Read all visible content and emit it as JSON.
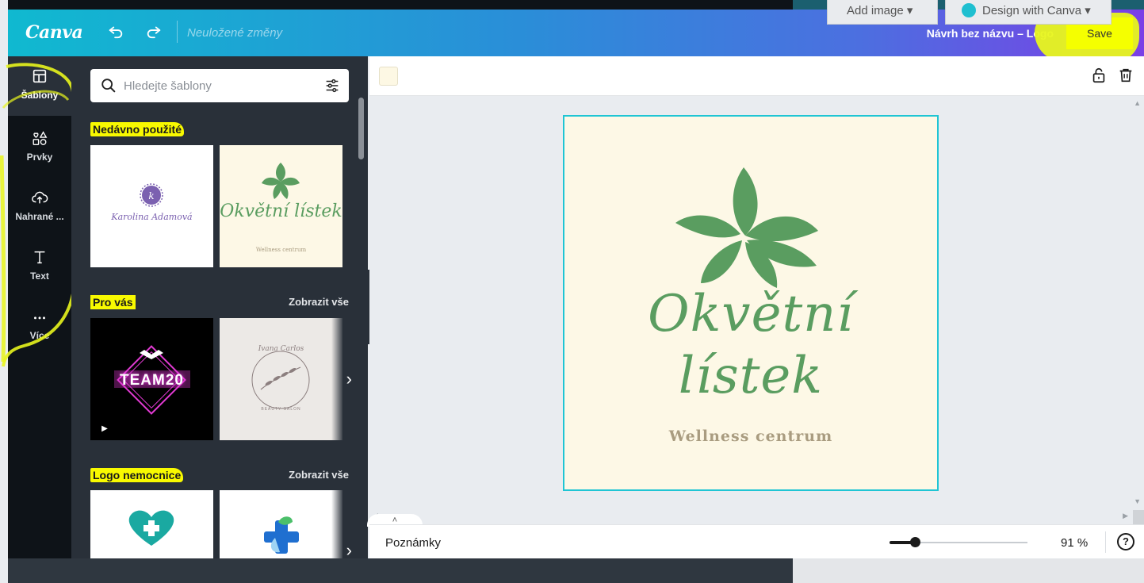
{
  "app": {
    "logo": "Canva",
    "unsaved": "Neuložené změny",
    "doc_title": "Návrh bez názvu – Logo",
    "save_label": "Save"
  },
  "rail": {
    "items": [
      {
        "label": "Šablony",
        "icon": "template-icon"
      },
      {
        "label": "Prvky",
        "icon": "shapes-icon"
      },
      {
        "label": "Nahrané ...",
        "icon": "upload-cloud-icon"
      },
      {
        "label": "Text",
        "icon": "text-icon"
      },
      {
        "label": "Více",
        "icon": "more-dots-icon"
      }
    ]
  },
  "panel": {
    "search_placeholder": "Hledejte šablony",
    "sections": [
      {
        "title": "Nedávno použité",
        "show_all": ""
      },
      {
        "title": "Pro vás",
        "show_all": "Zobrazit vše"
      },
      {
        "title": "Logo nemocnice",
        "show_all": "Zobrazit vše"
      }
    ],
    "recent": [
      {
        "name": "Karolina Adamová"
      },
      {
        "name": "Okvětní lístek",
        "sub": "Wellness centrum"
      }
    ],
    "foryou": [
      {
        "name": "TEAM20"
      },
      {
        "name": "Ivana Carlos",
        "sub": "BEAUTY SALON"
      }
    ]
  },
  "design": {
    "brand_line1": "Okvětní",
    "brand_line2": "lístek",
    "tagline": "Wellness centrum",
    "background": "#fdf8e6",
    "accent": "#5a9d60"
  },
  "bottom": {
    "notes": "Poznámky",
    "zoom": 91,
    "zoom_label": "91 %",
    "help": "?"
  },
  "underlying": {
    "add_image": "Add image",
    "design_with": "Design with Canva"
  }
}
